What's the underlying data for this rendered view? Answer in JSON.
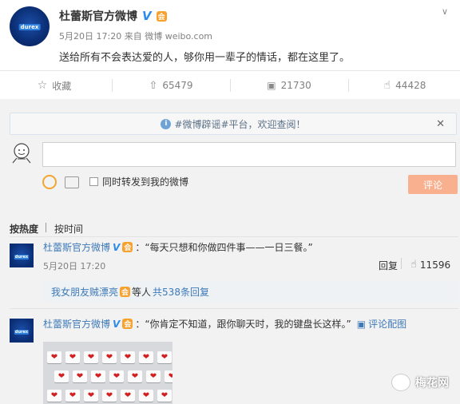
{
  "post": {
    "author": "杜蕾斯官方微博",
    "verified_mark": "V",
    "vip_badge": "会",
    "avatar_badge": "durex",
    "date": "5月20日 17:20",
    "source": "来自 微博 weibo.com",
    "text": "送给所有不会表达爱的人，够你用一辈子的情话，都在这里了。"
  },
  "actions": {
    "favorite": "收藏",
    "repost": "65479",
    "comment": "21730",
    "like": "44428"
  },
  "notice": {
    "text": "#微博辟谣#平台，欢迎查阅！"
  },
  "composer": {
    "repost_option": "同时转发到我的微博",
    "submit": "评论"
  },
  "sort": {
    "hot": "按热度",
    "time": "按时间"
  },
  "comments": [
    {
      "author": "杜蕾斯官方微博",
      "text": "：“每天只想和你做四件事——一日三餐。”",
      "date": "5月20日 17:20",
      "reply": "回复",
      "likes": "11596"
    },
    {
      "author": "杜蕾斯官方微博",
      "text": "：“你肯定不知道，跟你聊天时，我的键盘长这样。”",
      "image_link": "评论配图"
    }
  ],
  "reply_summary": {
    "user": "我女朋友贼漂亮",
    "middle": "等人",
    "count": "共538条回复"
  },
  "watermark": "梅花网",
  "colors": {
    "link": "#3e79b8",
    "button": "#f9b08f",
    "verified": "#2d8ceb",
    "vip": "#f7a12e"
  }
}
